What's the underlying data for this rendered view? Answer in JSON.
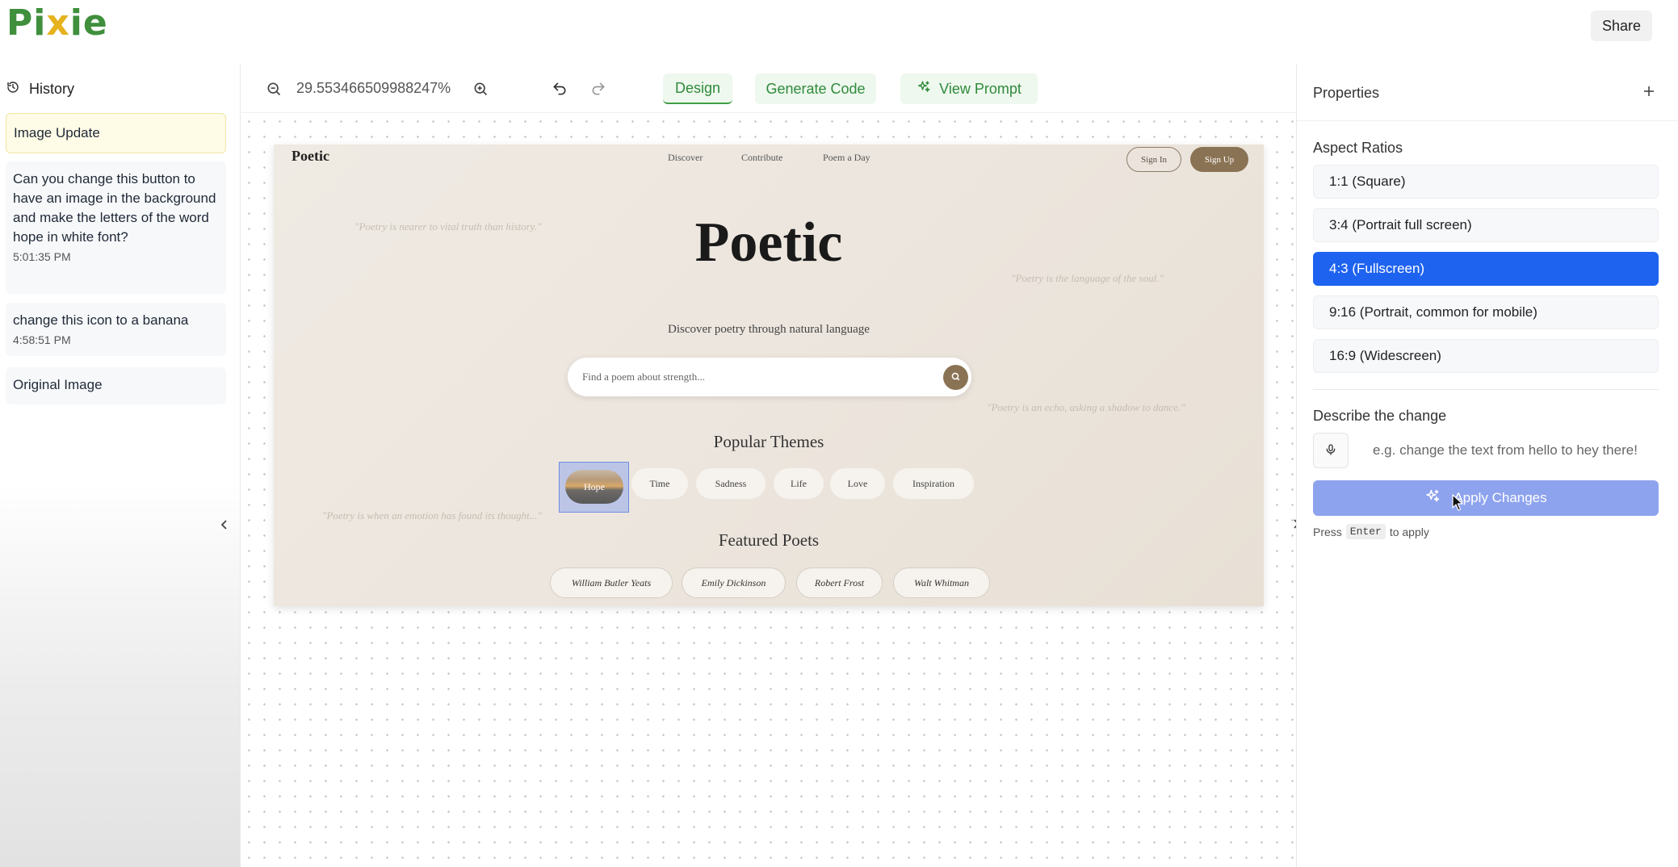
{
  "app": {
    "logo_text_a": "Pi",
    "logo_text_x": "x",
    "logo_text_b": "ie",
    "share_label": "Share"
  },
  "history": {
    "title": "History",
    "items": [
      {
        "text": "Image Update",
        "time": ""
      },
      {
        "text": "Can you change this button to have an image in the background and make the letters of the word hope in white font?",
        "time": "5:01:35 PM"
      },
      {
        "text": "change this icon to a banana",
        "time": "4:58:51 PM"
      },
      {
        "text": "Original Image",
        "time": ""
      }
    ]
  },
  "toolbar": {
    "zoom": "29.553466509988247%",
    "tabs": [
      "Design",
      "Generate Code",
      "View Prompt"
    ],
    "active_tab": "Design"
  },
  "preview": {
    "logo": "Poetic",
    "nav": [
      "Discover",
      "Contribute",
      "Poem a Day"
    ],
    "signin": "Sign In",
    "signup": "Sign Up",
    "title": "Poetic",
    "subtitle": "Discover poetry through natural language",
    "search_placeholder": "Find a poem about strength...",
    "quotes": [
      "\"Poetry is nearer to vital truth than history.\"",
      "\"Poetry is the language of the soul.\"",
      "\"Poetry is an echo, asking a shadow to dance.\"",
      "\"Poetry is when an emotion has found its thought...\""
    ],
    "themes_heading": "Popular Themes",
    "themes": [
      "Hope",
      "Time",
      "Sadness",
      "Life",
      "Love",
      "Inspiration"
    ],
    "poets_heading": "Featured Poets",
    "poets": [
      "William Butler Yeats",
      "Emily Dickinson",
      "Robert Frost",
      "Walt Whitman"
    ]
  },
  "properties": {
    "title": "Properties",
    "aspect_label": "Aspect Ratios",
    "ratios": [
      "1:1 (Square)",
      "3:4 (Portrait full screen)",
      "4:3 (Fullscreen)",
      "9:16 (Portrait, common for mobile)",
      "16:9 (Widescreen)"
    ],
    "selected_ratio": "4:3 (Fullscreen)",
    "describe_label": "Describe the change",
    "change_placeholder": "e.g. change the text from hello to hey there!",
    "apply_label": "Apply Changes",
    "hint_press": "Press",
    "hint_key": "Enter",
    "hint_after": "to apply"
  },
  "colors": {
    "brand_green": "#3f8f3c",
    "brand_yellow": "#e6b21d",
    "selected_blue": "#1e63f0",
    "apply_button": "#8ea3ee",
    "preview_accent": "#8a7354"
  }
}
